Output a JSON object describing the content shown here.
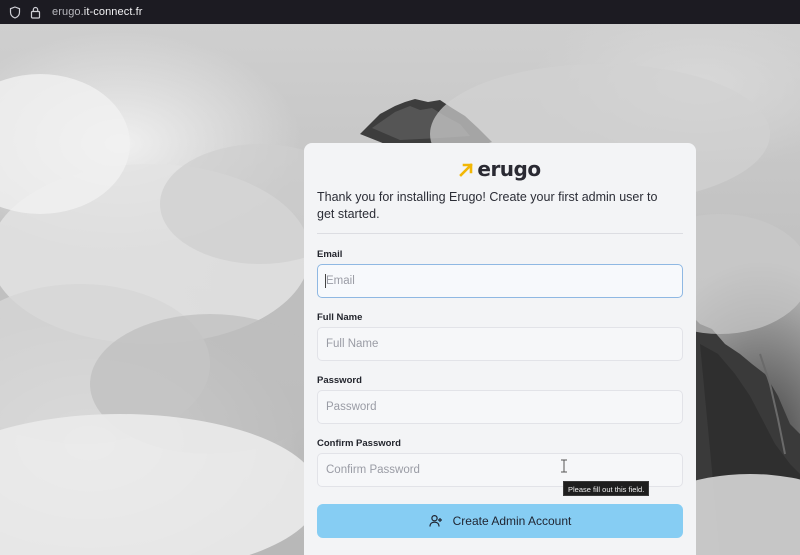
{
  "browser": {
    "url_prefix": "erugo.",
    "url_host": "it-connect.fr",
    "icons": [
      "shield-icon",
      "lock-icon"
    ]
  },
  "logo": {
    "wordmark": "erugo",
    "accent_color": "#f2b705"
  },
  "intro": "Thank you for installing Erugo! Create your first admin user to get started.",
  "form": {
    "email": {
      "label": "Email",
      "placeholder": "Email",
      "value": ""
    },
    "full_name": {
      "label": "Full Name",
      "placeholder": "Full Name",
      "value": ""
    },
    "password": {
      "label": "Password",
      "placeholder": "Password",
      "value": ""
    },
    "confirm_password": {
      "label": "Confirm Password",
      "placeholder": "Confirm Password",
      "value": ""
    },
    "validation_tooltip": "Please fill out this field.",
    "submit_label": "Create Admin Account",
    "submit_icon": "user-plus-icon"
  },
  "colors": {
    "button": "#86cdf3",
    "focus_border": "#8fb8e3",
    "card": "#f3f4f6"
  }
}
